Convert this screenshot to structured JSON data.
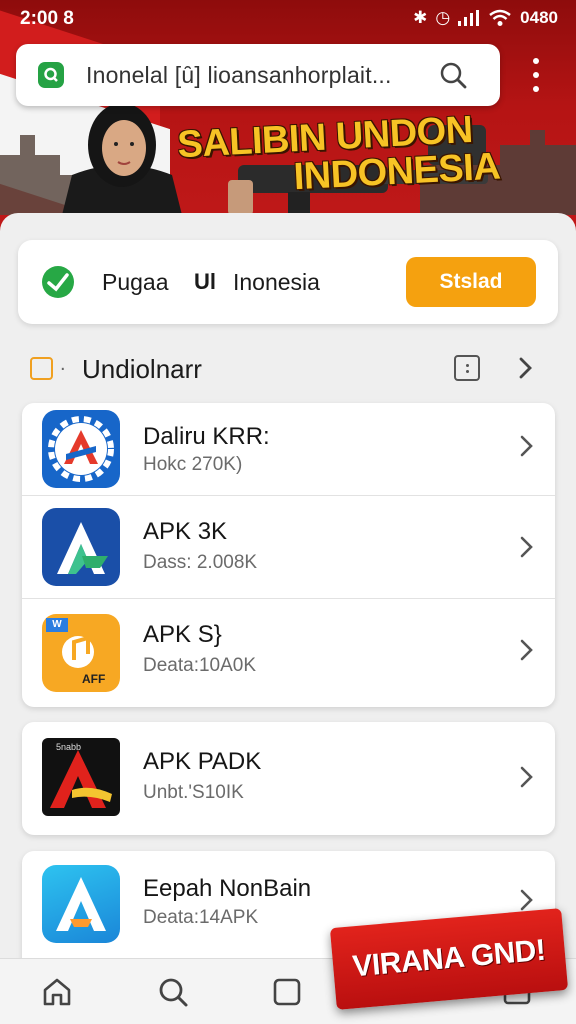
{
  "status_bar": {
    "time": "2:00 8",
    "right_text": "0480"
  },
  "browser": {
    "url": "Inonelal [ȗ] lioansanhorplait...",
    "accent": "#25a244"
  },
  "banner": {
    "headline_line1": "SALIBIN UNDON",
    "headline_line2": "INDONESIA",
    "headline_color": "#f7c325",
    "background": "#b51414"
  },
  "language_card": {
    "option1": "Pugaa",
    "option2_icon": "Ul",
    "option2": "Inonesia",
    "button_label": "Stslad",
    "button_color": "#f5a10f"
  },
  "section": {
    "title": "Undiolnarr"
  },
  "apps_group1": [
    {
      "name": "Daliru KRR:",
      "meta": "Hokc 270K)",
      "icon": "gear-a-icon"
    },
    {
      "name": "APK 3K",
      "meta": "Dass: 2.008K",
      "icon": "a-logo-icon"
    },
    {
      "name": "APK S}",
      "meta": "Deata:10A0K",
      "icon": "music-note-icon"
    }
  ],
  "apps_group2": [
    {
      "name": "APK PADK",
      "meta": "Unbt.'S10IK",
      "icon": "red-a-icon"
    }
  ],
  "apps_group3": [
    {
      "name": "Eepah NonBain",
      "meta": "Deata:14APK",
      "icon": "blue-a-icon"
    }
  ],
  "app3_icon_text": {
    "top": "W",
    "bottom": "AFF"
  },
  "app4_icon_text": "5nabb",
  "promo_badge": "VIRANA GND!",
  "bottom_nav": [
    "home-icon",
    "search-icon",
    "square-icon",
    "profile-icon",
    "menu-icon"
  ]
}
